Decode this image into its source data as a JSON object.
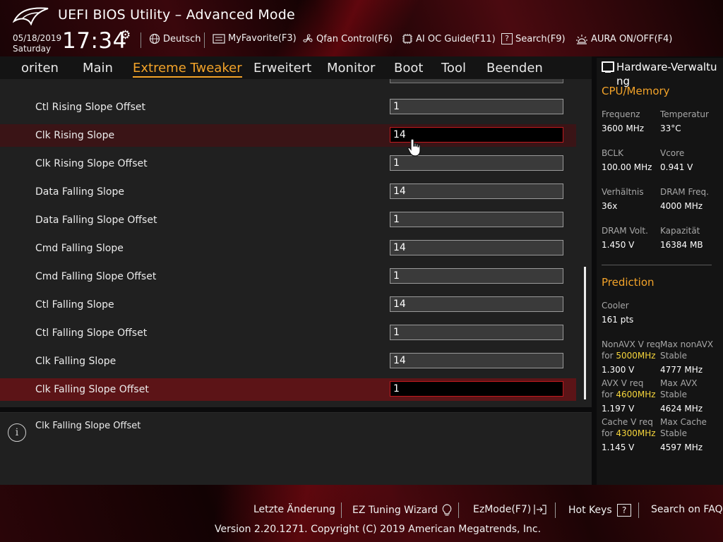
{
  "header": {
    "title": "UEFI BIOS Utility – Advanced Mode",
    "date": "05/18/2019",
    "weekday": "Saturday",
    "time": "17:34",
    "tools": [
      {
        "label": "Deutsch",
        "icon": "globe-icon"
      },
      {
        "label": "MyFavorite(F3)",
        "icon": "favorite-icon"
      },
      {
        "label": "Qfan Control(F6)",
        "icon": "fan-icon"
      },
      {
        "label": "AI OC Guide(F11)",
        "icon": "ai-oc-icon"
      },
      {
        "label": "Search(F9)",
        "icon": "search-icon"
      },
      {
        "label": "AURA ON/OFF(F4)",
        "icon": "aura-icon"
      }
    ]
  },
  "nav": {
    "tabs": [
      "oriten",
      "Main",
      "Extreme Tweaker",
      "Erweitert",
      "Monitor",
      "Boot",
      "Tool",
      "Beenden"
    ],
    "active": "Extreme Tweaker"
  },
  "settings": [
    {
      "label": "Ctl Rising Slope Offset",
      "value": "1"
    },
    {
      "label": "Clk Rising Slope",
      "value": "14"
    },
    {
      "label": "Clk Rising Slope Offset",
      "value": "1"
    },
    {
      "label": "Data Falling Slope",
      "value": "14"
    },
    {
      "label": "Data Falling Slope Offset",
      "value": "1"
    },
    {
      "label": "Cmd Falling Slope",
      "value": "14"
    },
    {
      "label": "Cmd Falling Slope Offset",
      "value": "1"
    },
    {
      "label": "Ctl Falling Slope",
      "value": "14"
    },
    {
      "label": "Ctl Falling Slope Offset",
      "value": "1"
    },
    {
      "label": "Clk Falling Slope",
      "value": "14"
    },
    {
      "label": "Clk Falling Slope Offset",
      "value": "1"
    }
  ],
  "help": {
    "text": "Clk Falling Slope Offset"
  },
  "hardware": {
    "title": "Hardware-Verwaltung",
    "cpu_memory": {
      "heading": "CPU/Memory",
      "items": [
        {
          "k": "Frequenz",
          "v": "3600 MHz"
        },
        {
          "k": "Temperatur",
          "v": "33°C"
        },
        {
          "k": "BCLK",
          "v": "100.00 MHz"
        },
        {
          "k": "Vcore",
          "v": "0.941 V"
        },
        {
          "k": "Verhältnis",
          "v": "36x"
        },
        {
          "k": "DRAM Freq.",
          "v": "4000 MHz"
        },
        {
          "k": "DRAM Volt.",
          "v": "1.450 V"
        },
        {
          "k": "Kapazität",
          "v": "16384 MB"
        }
      ]
    },
    "prediction": {
      "heading": "Prediction",
      "cooler_label": "Cooler",
      "cooler_value": "161 pts",
      "nonavx_req_label": "NonAVX V req",
      "nonavx_for": "for",
      "nonavx_freq": "5000MHz",
      "nonavx_req_value": "1.300 V",
      "nonavx_max_label_1": "Max nonAVX",
      "nonavx_max_label_2": "Stable",
      "nonavx_max_value": "4777 MHz",
      "avx_req_label": "AVX V req",
      "avx_for": "for",
      "avx_freq": "4600MHz",
      "avx_req_value": "1.197 V",
      "avx_max_label_1": "Max AVX",
      "avx_max_label_2": "Stable",
      "avx_max_value": "4624 MHz",
      "cache_req_label": "Cache V req",
      "cache_for": "for",
      "cache_freq": "4300MHz",
      "cache_req_value": "1.145 V",
      "cache_max_label_1": "Max Cache",
      "cache_max_label_2": "Stable",
      "cache_max_value": "4597 MHz"
    }
  },
  "footer": {
    "last_change": "Letzte Änderung",
    "ez_tuning": "EZ Tuning Wizard",
    "ezmode": "EzMode(F7)",
    "hotkeys": "Hot Keys",
    "hotkeys_key": "?",
    "faq": "Search on FAQ",
    "version": "Version 2.20.1271. Copyright (C) 2019 American Megatrends, Inc."
  },
  "colors": {
    "accent": "#f3a329",
    "highlight_row": "#5c1417",
    "selected_border": "#c41a1f",
    "freq_yellow": "#f6d53b"
  }
}
